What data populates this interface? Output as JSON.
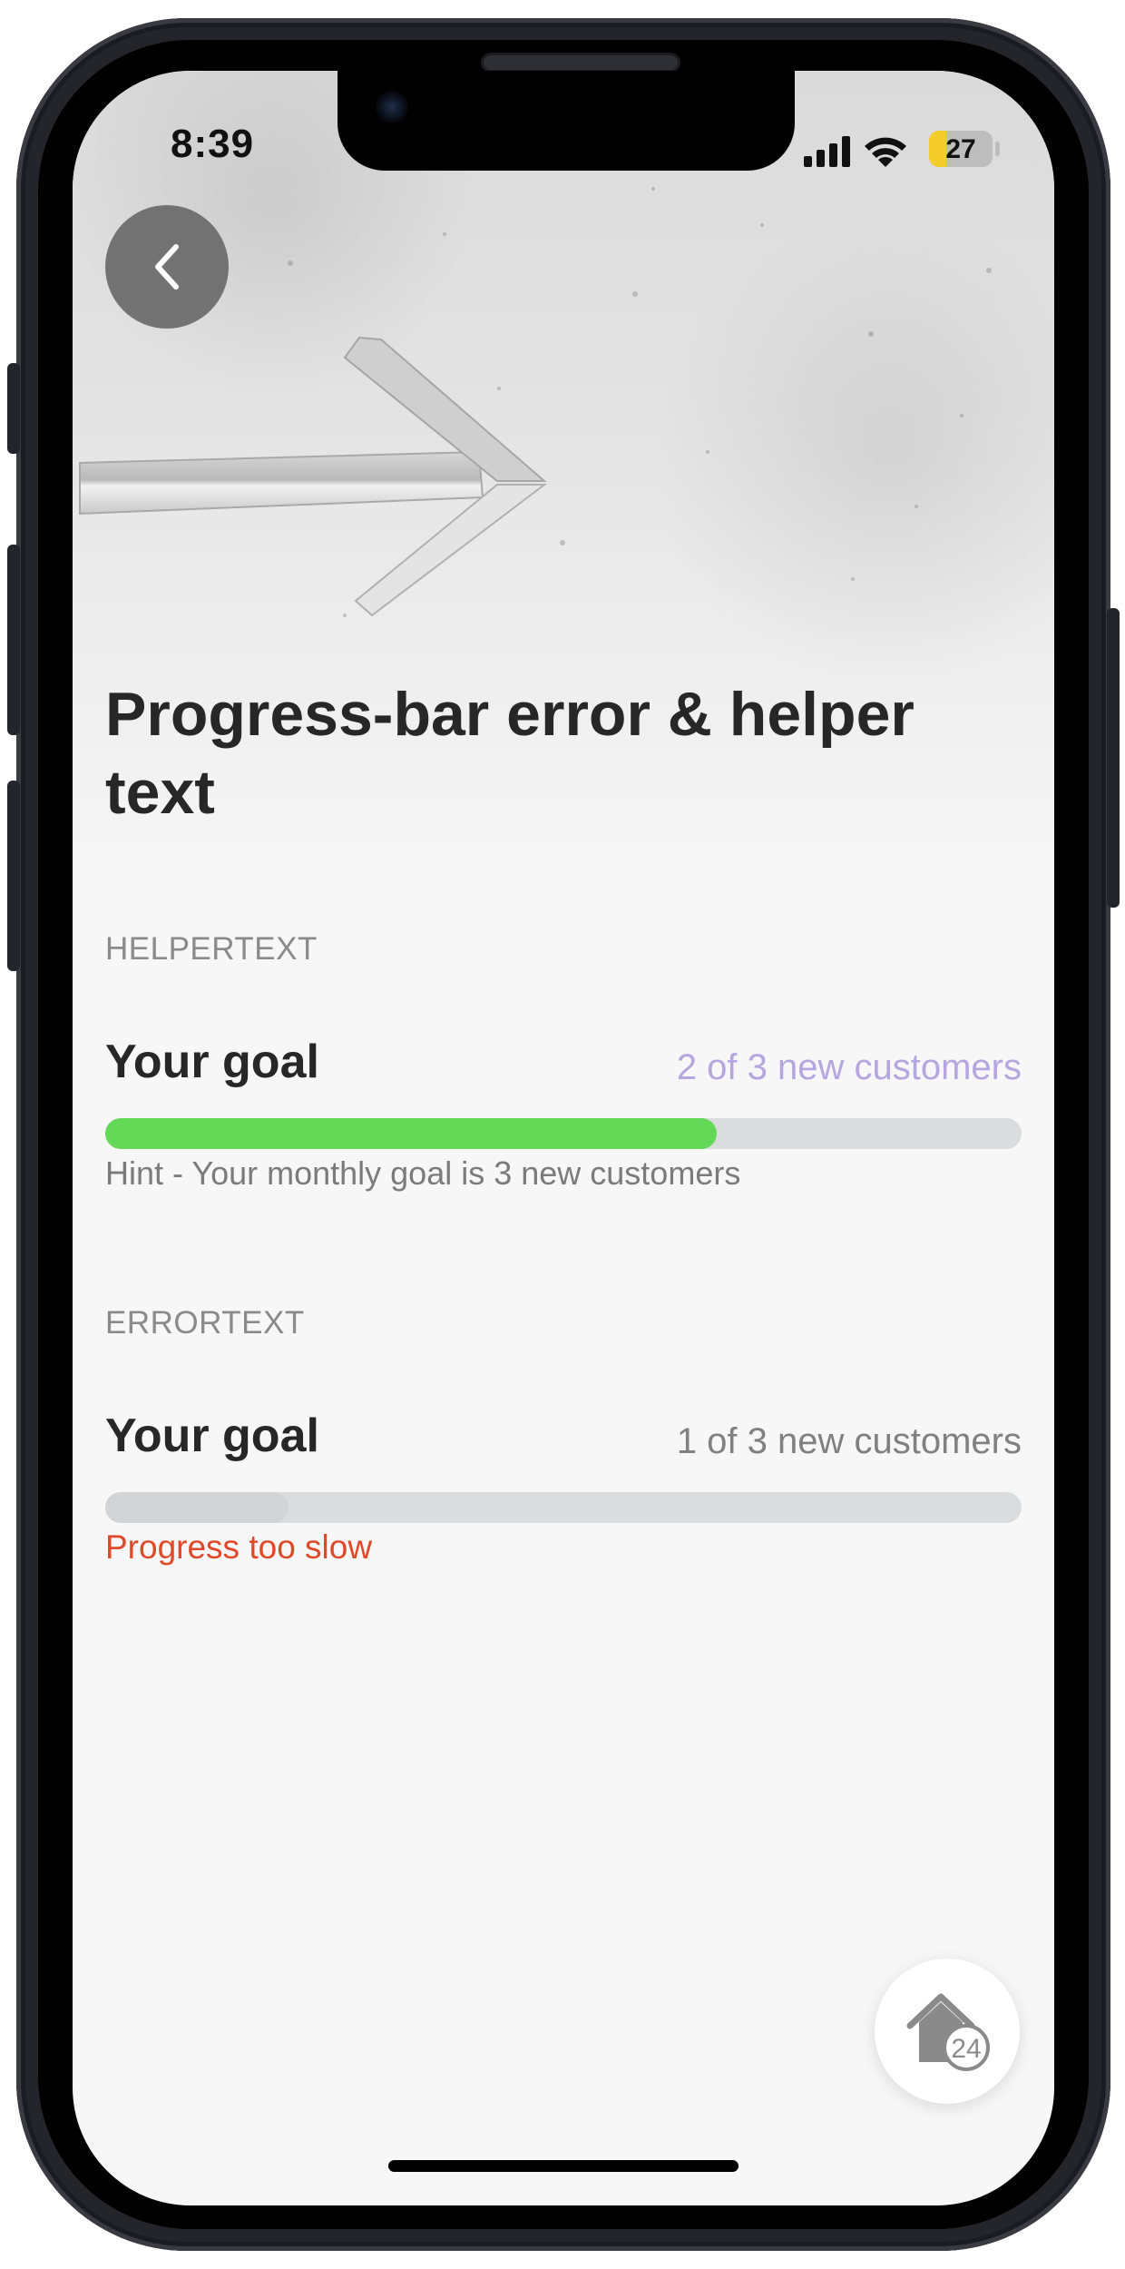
{
  "status_bar": {
    "time": "8:39",
    "battery_percent": "27",
    "battery_level": 0.27,
    "icons": [
      "signal-icon",
      "wifi-icon",
      "battery-charging-icon"
    ]
  },
  "header": {
    "back_icon": "chevron-left-icon",
    "hero_image": "arrow-carved-in-concrete"
  },
  "page": {
    "title": "Progress-bar error & helper text"
  },
  "sections": [
    {
      "label": "HELPERTEXT",
      "goal_title": "Your goal",
      "goal_value": "2 of 3 new customers",
      "progress": 0.667,
      "fill_color": "#63d957",
      "value_color": "#b5a6e0",
      "message": "Hint - Your monthly goal is 3 new customers",
      "message_type": "helper"
    },
    {
      "label": "ERRORTEXT",
      "goal_title": "Your goal",
      "goal_value": "1 of 3 new customers",
      "progress": 0.2,
      "fill_color": "#d3d4d5",
      "value_color": "#808080",
      "message": "Progress too slow",
      "message_type": "error",
      "message_color": "#e0482a"
    }
  ],
  "fab": {
    "icon": "home-24-icon",
    "badge": "24"
  },
  "colors": {
    "background": "#f7f7f7",
    "title": "#272727",
    "track": "#dadcdd",
    "error": "#e0482a",
    "helper_fill": "#63d957"
  }
}
